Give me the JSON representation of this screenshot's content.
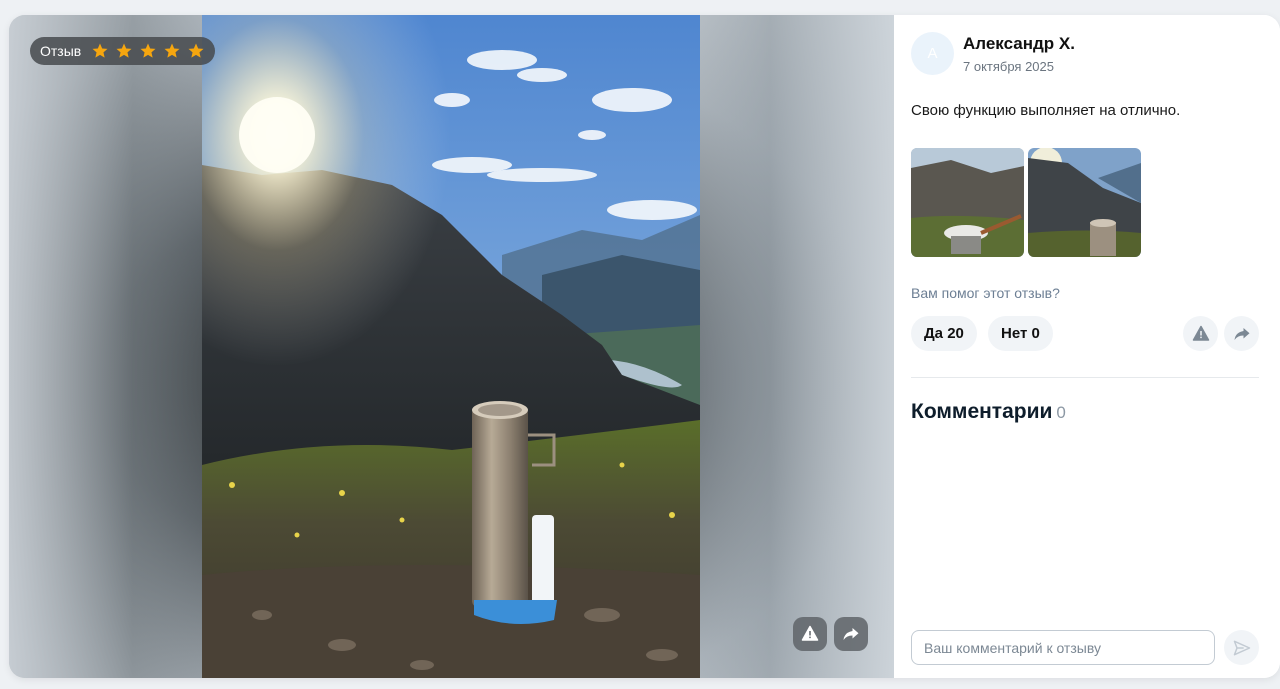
{
  "media": {
    "rating_label": "Отзыв",
    "stars": 5,
    "star_color": "#f6a60f"
  },
  "review": {
    "avatar_letter": "А",
    "author": "Александр Х.",
    "date": "7 октября 2025",
    "text": "Свою функцию выполняет на отлично.",
    "helpful_question": "Вам помог этот отзыв?",
    "yes_label": "Да 20",
    "no_label": "Нет 0"
  },
  "comments": {
    "title": "Комментарии",
    "count": "0",
    "input_placeholder": "Ваш комментарий к отзыву"
  },
  "icons": [
    "star-icon",
    "report-icon",
    "share-icon",
    "send-icon"
  ]
}
